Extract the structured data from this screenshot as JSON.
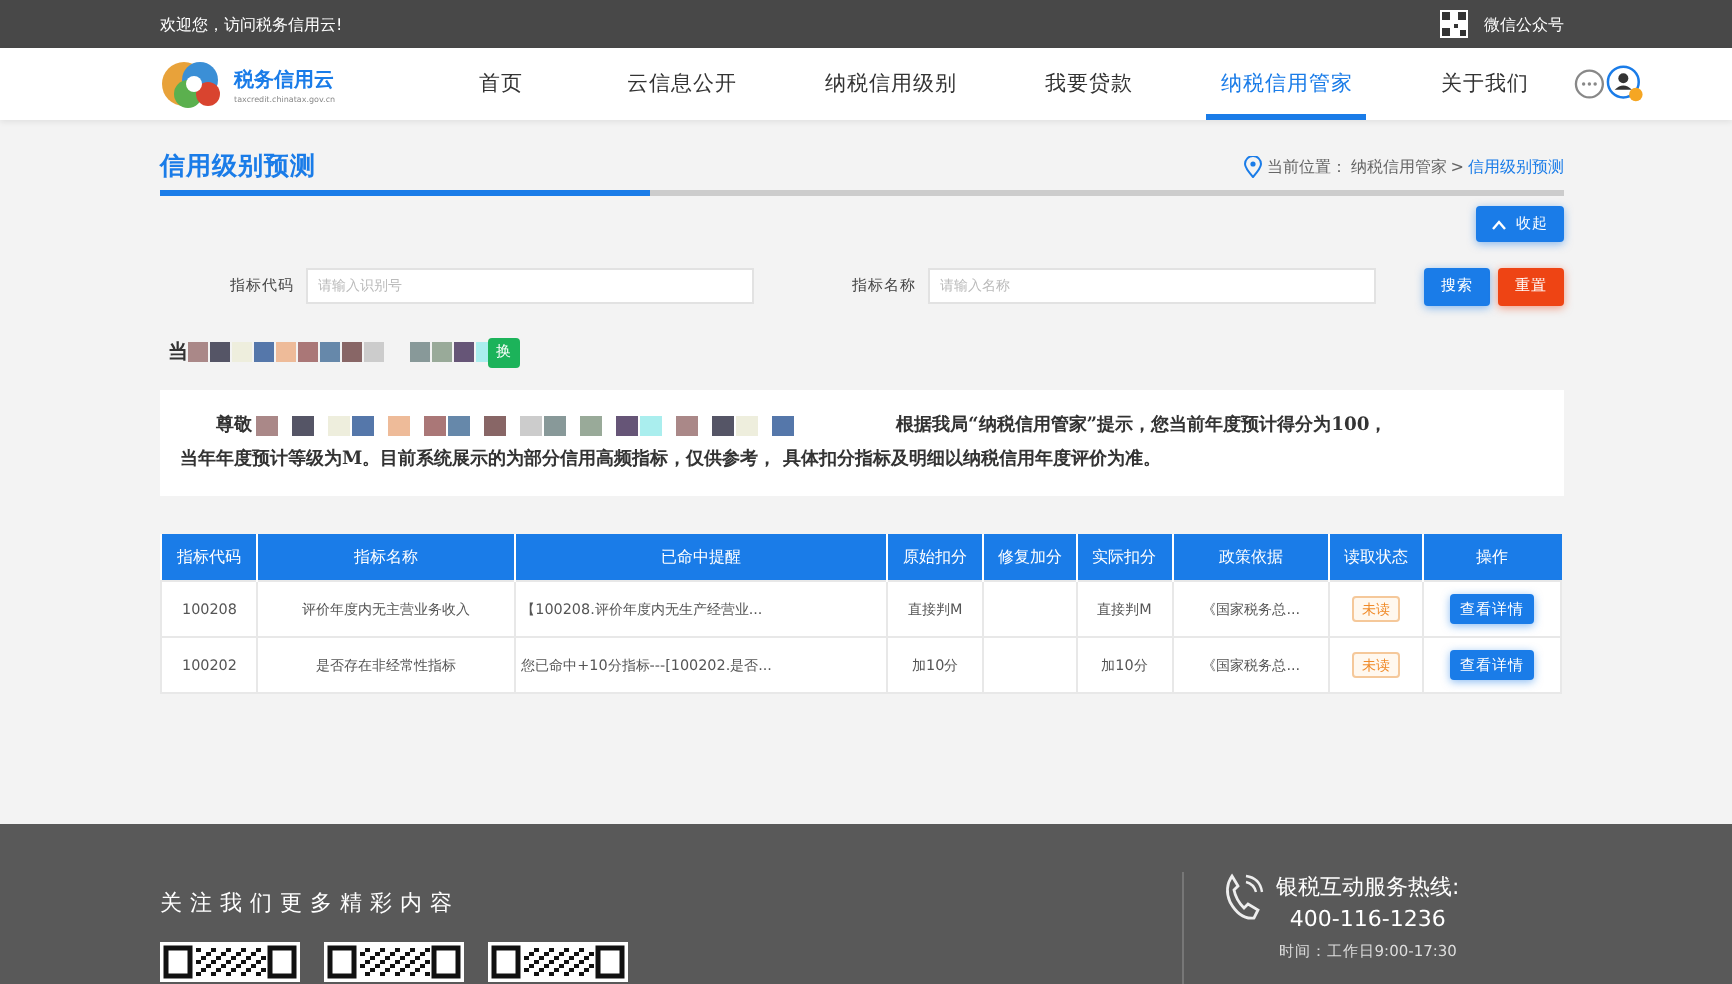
{
  "top_bar": {
    "welcome": "欢迎您，访问税务信用云!",
    "wechat": "微信公众号"
  },
  "logo": {
    "name": "税务信用云",
    "subtitle": "taxcredit.chinatax.gov.cn"
  },
  "nav": [
    {
      "label": "首页",
      "selected": false
    },
    {
      "label": "云信息公开",
      "selected": false
    },
    {
      "label": "纳税信用级别",
      "selected": false
    },
    {
      "label": "我要贷款",
      "selected": false
    },
    {
      "label": "纳税信用管家",
      "selected": true
    },
    {
      "label": "关于我们",
      "selected": false
    }
  ],
  "page_title": "信用级别预测",
  "breadcrumb": {
    "prefix": "当前位置：",
    "parent": "纳税信用管家",
    "separator": ">",
    "current": "信用级别预测"
  },
  "collapse_button": "收起",
  "search": {
    "fields": [
      {
        "label": "指标代码",
        "placeholder": "请输入识别号"
      },
      {
        "label": "指标名称",
        "placeholder": "请输入名称"
      }
    ],
    "buttons": [
      "搜索",
      "重置"
    ]
  },
  "current_label": "当",
  "switch_button": "换",
  "notice": {
    "greeting": "尊敬",
    "lines": [
      "根据我局“纳税信用管家”提示，您当前年度预计得分为100，",
      "当年年度预计等级为M。目前系统展示的为部分信用高频指标，仅供参考， 具体扣分指标及明细以纳税信用年度评价为准。"
    ]
  },
  "table": {
    "columns": [
      "指标代码",
      "指标名称",
      "已命中提醒",
      "原始扣分",
      "修复加分",
      "实际扣分",
      "政策依据",
      "读取状态",
      "操作"
    ],
    "rows": [
      [
        "100208",
        "评价年度内无主营业务收入",
        "【100208.评价年度内无生产经营业...",
        "直接判M",
        "",
        "直接判M",
        "《国家税务总...",
        "未读",
        "查看详情"
      ],
      [
        "100202",
        "是否存在非经常性指标",
        "您已命中+10分指标---[100202.是否...",
        "加10分",
        "",
        "加10分",
        "《国家税务总...",
        "未读",
        "查看详情"
      ]
    ]
  },
  "footer": {
    "follow": "关注我们更多精彩内容",
    "hotline_label": "银税互动服务热线:",
    "hotline": "400-116-1236",
    "hours": "时间：工作日9:00-17:30"
  }
}
